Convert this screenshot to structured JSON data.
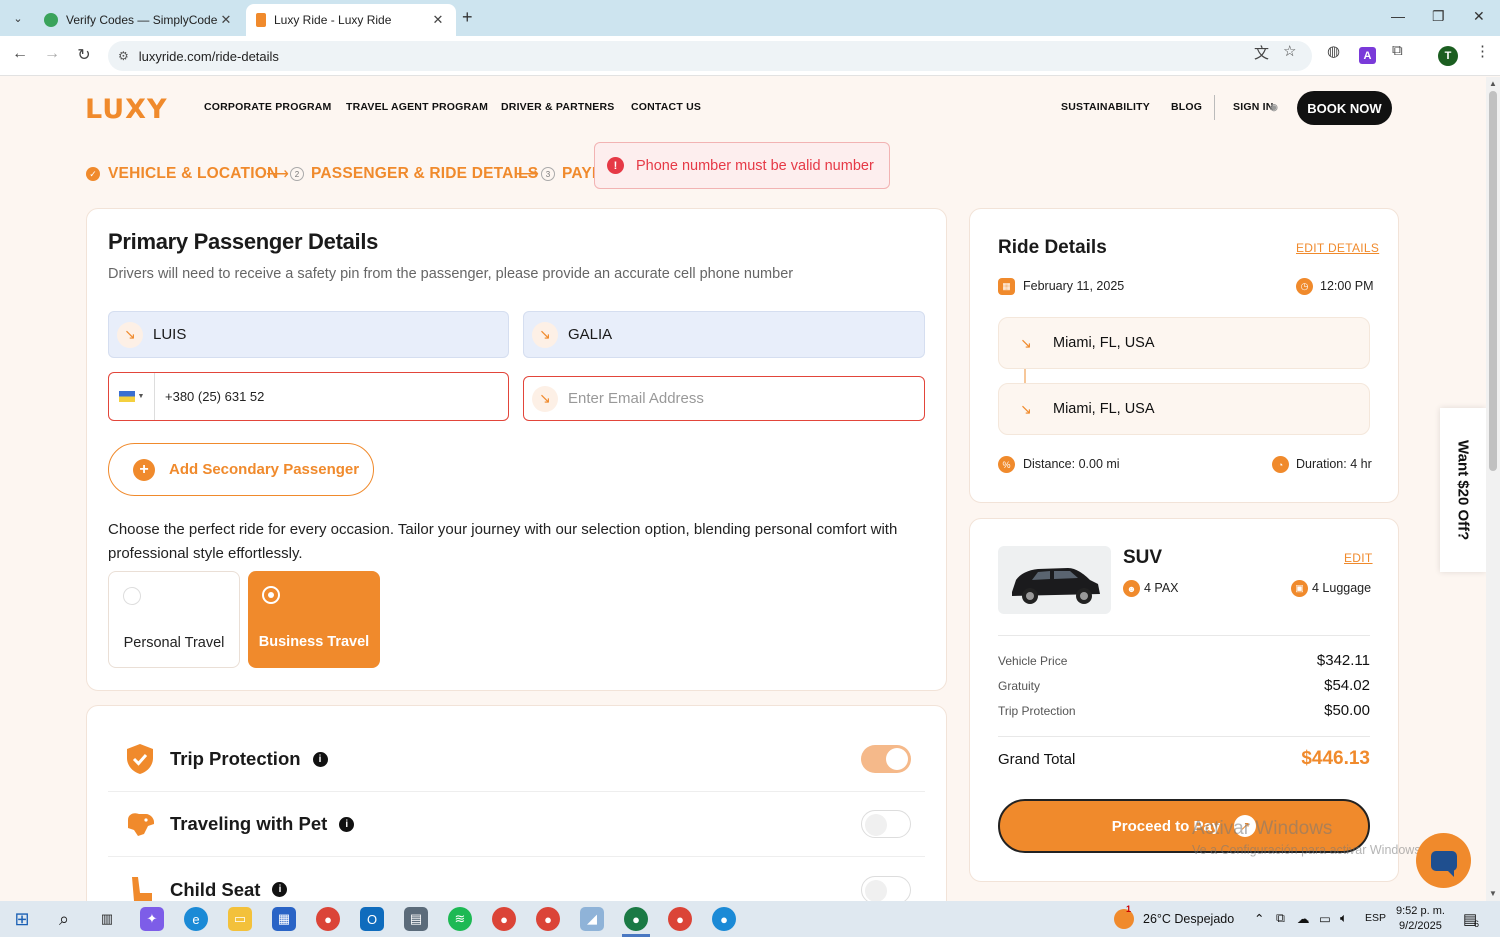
{
  "browser": {
    "tabs": [
      {
        "title": "Verify Codes — SimplyCodes",
        "active": false
      },
      {
        "title": "Luxy Ride - Luxy Ride",
        "active": true
      }
    ],
    "url": "luxyride.com/ride-details",
    "profile_initial": "T",
    "extension_letter": "A"
  },
  "site": {
    "logo": "LUXY",
    "nav_left": [
      "CORPORATE PROGRAM",
      "TRAVEL AGENT PROGRAM",
      "DRIVER & PARTNERS",
      "CONTACT US"
    ],
    "nav_right": [
      "SUSTAINABILITY",
      "BLOG",
      "SIGN IN"
    ],
    "book_now": "BOOK NOW",
    "accent_color": "#f08a2c"
  },
  "steps": {
    "step1": "VEHICLE & LOCATION",
    "step2_num": "2",
    "step2": "PASSENGER & RIDE DETAILS",
    "step3_num": "3",
    "step3": "PAYM"
  },
  "toast": {
    "message": "Phone number must be valid number",
    "color": "#e63946"
  },
  "passenger": {
    "title": "Primary Passenger Details",
    "subtitle": "Drivers will need to receive a safety pin from the passenger, please provide an accurate cell phone number",
    "first_name": "LUIS",
    "last_name": "GALIA",
    "phone": "+380 (25) 631 52",
    "email_placeholder": "Enter Email Address",
    "add_secondary": "Add Secondary Passenger",
    "choose_text": "Choose the perfect ride for every occasion. Tailor your journey with our selection option, blending personal comfort with professional style effortlessly.",
    "travel_options": [
      "Personal Travel",
      "Business Travel"
    ],
    "selected_travel": "Business Travel"
  },
  "extras": [
    {
      "label": "Trip Protection",
      "icon": "shield-check-icon",
      "enabled": true
    },
    {
      "label": "Traveling with Pet",
      "icon": "dog-icon",
      "enabled": false
    },
    {
      "label": "Child Seat",
      "icon": "child-seat-icon",
      "enabled": false
    }
  ],
  "ride": {
    "title": "Ride Details",
    "edit_details": "EDIT DETAILS",
    "date": "February 11, 2025",
    "time": "12:00 PM",
    "pickup": "Miami, FL, USA",
    "dropoff": "Miami, FL, USA",
    "distance": "Distance: 0.00 mi",
    "duration": "Duration: 4 hr"
  },
  "vehicle": {
    "name": "SUV",
    "edit": "EDIT",
    "pax": "4 PAX",
    "luggage": "4 Luggage"
  },
  "pricing": {
    "vehicle_price_label": "Vehicle Price",
    "vehicle_price": "$342.11",
    "gratuity_label": "Gratuity",
    "gratuity": "$54.02",
    "trip_protection_label": "Trip Protection",
    "trip_protection": "$50.00",
    "grand_total_label": "Grand Total",
    "grand_total": "$446.13",
    "proceed": "Proceed to Pay"
  },
  "side_promo": "Want $20 Off?",
  "watermark": {
    "line1": "Activar Windows",
    "line2": "Ve a Configuración para activar Windows."
  },
  "taskbar": {
    "weather": "26°C  Despejado",
    "weather_badge": "1",
    "language": "ESP",
    "time": "9:52 p. m.",
    "date": "9/2/2025",
    "notifications": "6"
  }
}
